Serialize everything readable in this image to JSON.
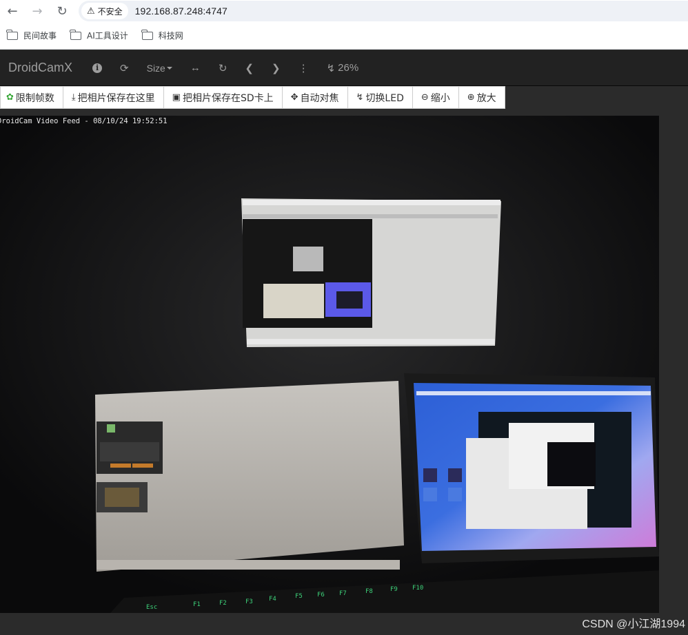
{
  "browser": {
    "security_label": "不安全",
    "url": "192.168.87.248:4747",
    "bookmarks": [
      "民间故事",
      "AI工具设计",
      "科技网"
    ]
  },
  "navbar": {
    "brand": "DroidCamX",
    "size_label": "Size",
    "battery_label": "26%"
  },
  "toolbar": {
    "buttons": [
      "限制帧数",
      "把相片保存在这里",
      "把相片保存在SD卡上",
      "自动对焦",
      "切换LED",
      "缩小",
      "放大"
    ]
  },
  "video": {
    "caption": "DroidCam Video Feed - 08/10/24 19:52:51"
  },
  "watermark": "CSDN @小江湖1994"
}
